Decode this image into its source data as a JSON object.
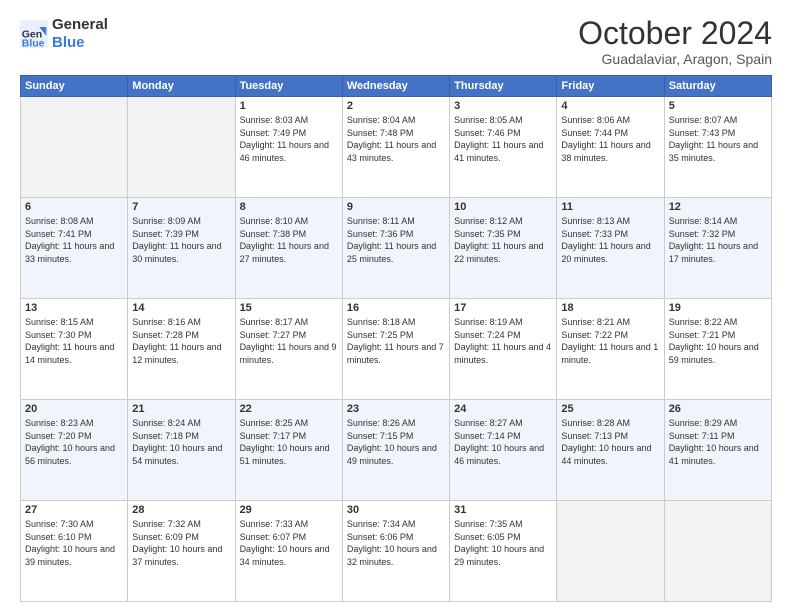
{
  "logo": {
    "general": "General",
    "blue": "Blue"
  },
  "title": "October 2024",
  "location": "Guadalaviar, Aragon, Spain",
  "weekdays": [
    "Sunday",
    "Monday",
    "Tuesday",
    "Wednesday",
    "Thursday",
    "Friday",
    "Saturday"
  ],
  "weeks": [
    [
      {
        "day": "",
        "sunrise": "",
        "sunset": "",
        "daylight": ""
      },
      {
        "day": "",
        "sunrise": "",
        "sunset": "",
        "daylight": ""
      },
      {
        "day": "1",
        "sunrise": "Sunrise: 8:03 AM",
        "sunset": "Sunset: 7:49 PM",
        "daylight": "Daylight: 11 hours and 46 minutes."
      },
      {
        "day": "2",
        "sunrise": "Sunrise: 8:04 AM",
        "sunset": "Sunset: 7:48 PM",
        "daylight": "Daylight: 11 hours and 43 minutes."
      },
      {
        "day": "3",
        "sunrise": "Sunrise: 8:05 AM",
        "sunset": "Sunset: 7:46 PM",
        "daylight": "Daylight: 11 hours and 41 minutes."
      },
      {
        "day": "4",
        "sunrise": "Sunrise: 8:06 AM",
        "sunset": "Sunset: 7:44 PM",
        "daylight": "Daylight: 11 hours and 38 minutes."
      },
      {
        "day": "5",
        "sunrise": "Sunrise: 8:07 AM",
        "sunset": "Sunset: 7:43 PM",
        "daylight": "Daylight: 11 hours and 35 minutes."
      }
    ],
    [
      {
        "day": "6",
        "sunrise": "Sunrise: 8:08 AM",
        "sunset": "Sunset: 7:41 PM",
        "daylight": "Daylight: 11 hours and 33 minutes."
      },
      {
        "day": "7",
        "sunrise": "Sunrise: 8:09 AM",
        "sunset": "Sunset: 7:39 PM",
        "daylight": "Daylight: 11 hours and 30 minutes."
      },
      {
        "day": "8",
        "sunrise": "Sunrise: 8:10 AM",
        "sunset": "Sunset: 7:38 PM",
        "daylight": "Daylight: 11 hours and 27 minutes."
      },
      {
        "day": "9",
        "sunrise": "Sunrise: 8:11 AM",
        "sunset": "Sunset: 7:36 PM",
        "daylight": "Daylight: 11 hours and 25 minutes."
      },
      {
        "day": "10",
        "sunrise": "Sunrise: 8:12 AM",
        "sunset": "Sunset: 7:35 PM",
        "daylight": "Daylight: 11 hours and 22 minutes."
      },
      {
        "day": "11",
        "sunrise": "Sunrise: 8:13 AM",
        "sunset": "Sunset: 7:33 PM",
        "daylight": "Daylight: 11 hours and 20 minutes."
      },
      {
        "day": "12",
        "sunrise": "Sunrise: 8:14 AM",
        "sunset": "Sunset: 7:32 PM",
        "daylight": "Daylight: 11 hours and 17 minutes."
      }
    ],
    [
      {
        "day": "13",
        "sunrise": "Sunrise: 8:15 AM",
        "sunset": "Sunset: 7:30 PM",
        "daylight": "Daylight: 11 hours and 14 minutes."
      },
      {
        "day": "14",
        "sunrise": "Sunrise: 8:16 AM",
        "sunset": "Sunset: 7:28 PM",
        "daylight": "Daylight: 11 hours and 12 minutes."
      },
      {
        "day": "15",
        "sunrise": "Sunrise: 8:17 AM",
        "sunset": "Sunset: 7:27 PM",
        "daylight": "Daylight: 11 hours and 9 minutes."
      },
      {
        "day": "16",
        "sunrise": "Sunrise: 8:18 AM",
        "sunset": "Sunset: 7:25 PM",
        "daylight": "Daylight: 11 hours and 7 minutes."
      },
      {
        "day": "17",
        "sunrise": "Sunrise: 8:19 AM",
        "sunset": "Sunset: 7:24 PM",
        "daylight": "Daylight: 11 hours and 4 minutes."
      },
      {
        "day": "18",
        "sunrise": "Sunrise: 8:21 AM",
        "sunset": "Sunset: 7:22 PM",
        "daylight": "Daylight: 11 hours and 1 minute."
      },
      {
        "day": "19",
        "sunrise": "Sunrise: 8:22 AM",
        "sunset": "Sunset: 7:21 PM",
        "daylight": "Daylight: 10 hours and 59 minutes."
      }
    ],
    [
      {
        "day": "20",
        "sunrise": "Sunrise: 8:23 AM",
        "sunset": "Sunset: 7:20 PM",
        "daylight": "Daylight: 10 hours and 56 minutes."
      },
      {
        "day": "21",
        "sunrise": "Sunrise: 8:24 AM",
        "sunset": "Sunset: 7:18 PM",
        "daylight": "Daylight: 10 hours and 54 minutes."
      },
      {
        "day": "22",
        "sunrise": "Sunrise: 8:25 AM",
        "sunset": "Sunset: 7:17 PM",
        "daylight": "Daylight: 10 hours and 51 minutes."
      },
      {
        "day": "23",
        "sunrise": "Sunrise: 8:26 AM",
        "sunset": "Sunset: 7:15 PM",
        "daylight": "Daylight: 10 hours and 49 minutes."
      },
      {
        "day": "24",
        "sunrise": "Sunrise: 8:27 AM",
        "sunset": "Sunset: 7:14 PM",
        "daylight": "Daylight: 10 hours and 46 minutes."
      },
      {
        "day": "25",
        "sunrise": "Sunrise: 8:28 AM",
        "sunset": "Sunset: 7:13 PM",
        "daylight": "Daylight: 10 hours and 44 minutes."
      },
      {
        "day": "26",
        "sunrise": "Sunrise: 8:29 AM",
        "sunset": "Sunset: 7:11 PM",
        "daylight": "Daylight: 10 hours and 41 minutes."
      }
    ],
    [
      {
        "day": "27",
        "sunrise": "Sunrise: 7:30 AM",
        "sunset": "Sunset: 6:10 PM",
        "daylight": "Daylight: 10 hours and 39 minutes."
      },
      {
        "day": "28",
        "sunrise": "Sunrise: 7:32 AM",
        "sunset": "Sunset: 6:09 PM",
        "daylight": "Daylight: 10 hours and 37 minutes."
      },
      {
        "day": "29",
        "sunrise": "Sunrise: 7:33 AM",
        "sunset": "Sunset: 6:07 PM",
        "daylight": "Daylight: 10 hours and 34 minutes."
      },
      {
        "day": "30",
        "sunrise": "Sunrise: 7:34 AM",
        "sunset": "Sunset: 6:06 PM",
        "daylight": "Daylight: 10 hours and 32 minutes."
      },
      {
        "day": "31",
        "sunrise": "Sunrise: 7:35 AM",
        "sunset": "Sunset: 6:05 PM",
        "daylight": "Daylight: 10 hours and 29 minutes."
      },
      {
        "day": "",
        "sunrise": "",
        "sunset": "",
        "daylight": ""
      },
      {
        "day": "",
        "sunrise": "",
        "sunset": "",
        "daylight": ""
      }
    ]
  ]
}
